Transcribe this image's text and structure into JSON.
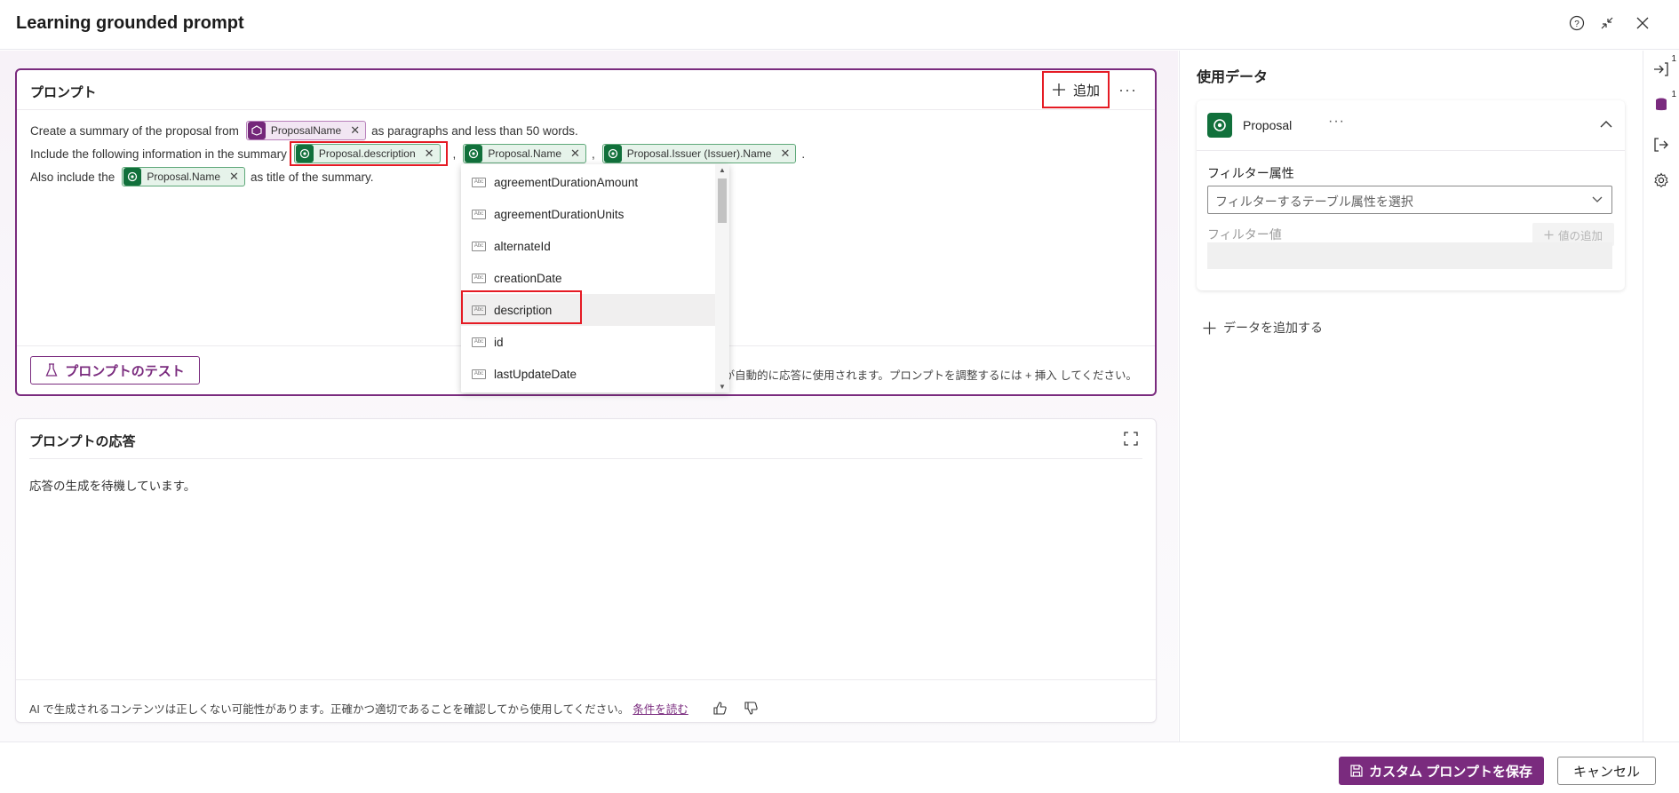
{
  "window": {
    "title": "Learning grounded prompt"
  },
  "prompt": {
    "title": "プロンプト",
    "add_label": "追加",
    "line1": {
      "before": "Create a summary of the proposal from",
      "chip": "ProposalName",
      "after": "as paragraphs and less than 50 words."
    },
    "line2": {
      "before": "Include the following information in the summary",
      "chip1": "Proposal.description",
      "sep1": ",",
      "chip2": "Proposal.Name",
      "sep2": ",",
      "chip3": "Proposal.Issuer (Issuer).Name",
      "end": "."
    },
    "line3": {
      "before": "Also include the",
      "chip": "Proposal.Name",
      "after": "as title of the summary."
    },
    "test_button": "プロンプトのテスト",
    "hint": "ータが自動的に応答に使用されます。プロンプトを調整するには + 挿入 してください。"
  },
  "dropdown": {
    "items": [
      "agreementDurationAmount",
      "agreementDurationUnits",
      "alternateId",
      "creationDate",
      "description",
      "id",
      "lastUpdateDate"
    ],
    "selected": "description"
  },
  "response": {
    "title": "プロンプトの応答",
    "body": "応答の生成を待機しています。",
    "disclaimer": "AI で生成されるコンテンツは正しくない可能性があります。正確かつ適切であることを確認してから使用してください。",
    "terms_link": "条件を読む"
  },
  "data_panel": {
    "title": "使用データ",
    "source_name": "Proposal",
    "filter_attr_label": "フィルター属性",
    "filter_attr_placeholder": "フィルターするテーブル属性を選択",
    "filter_value_label": "フィルター値",
    "add_value_label": "値の追加",
    "add_data_label": "データを追加する"
  },
  "rail": {
    "badge1": "1",
    "badge2": "1"
  },
  "footer": {
    "save": "カスタム プロンプトを保存",
    "cancel": "キャンセル"
  },
  "colors": {
    "brand": "#7a2b7e",
    "highlight": "#e51b24",
    "dataverse": "#11703b"
  }
}
